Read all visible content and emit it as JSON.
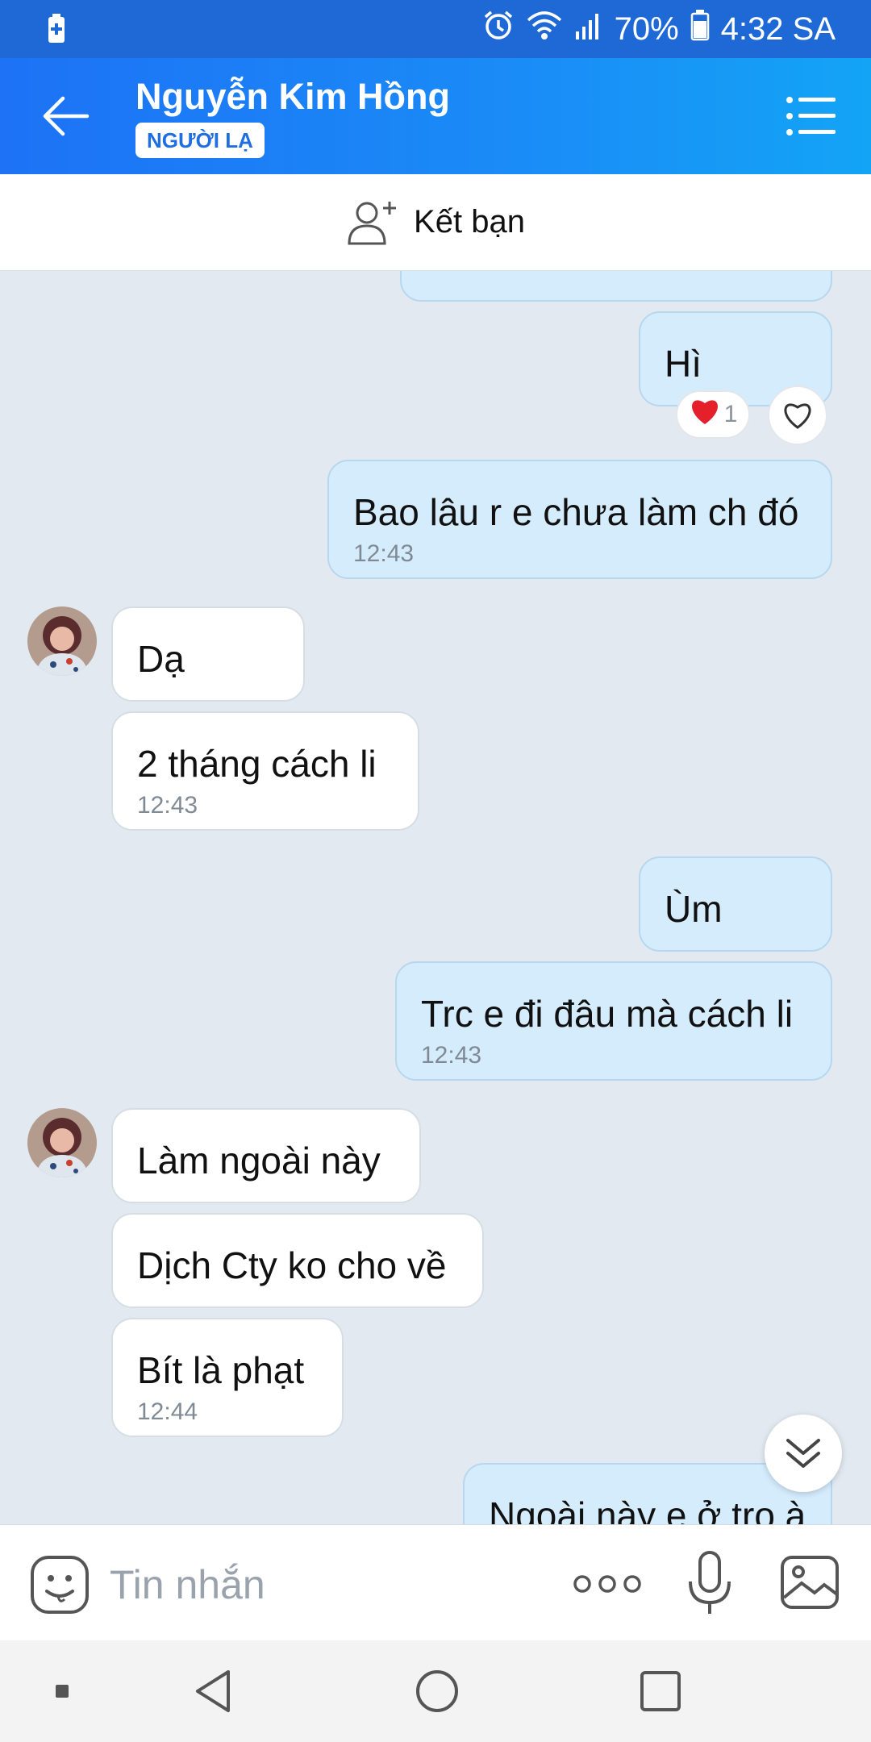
{
  "status_bar": {
    "battery_percent": "70%",
    "time": "4:32 SA",
    "icons": [
      "battery-saver-icon",
      "alarm-icon",
      "wifi-icon",
      "signal-icon",
      "battery-icon"
    ]
  },
  "header": {
    "name": "Nguyễn Kim Hồng",
    "badge": "NGƯỜI LẠ",
    "accent_color": "#1d72f5"
  },
  "friend_bar": {
    "label": "Kết bạn"
  },
  "messages": [
    {
      "id": "m0",
      "side": "sent",
      "text": "",
      "partial": true
    },
    {
      "id": "m1",
      "side": "sent",
      "text": "Hì",
      "reaction": {
        "emoji": "heart",
        "count": "1"
      }
    },
    {
      "id": "m2",
      "side": "sent",
      "text": "Bao lâu r e chưa làm ch đó",
      "time": "12:43"
    },
    {
      "id": "m3",
      "side": "received",
      "text": "Dạ"
    },
    {
      "id": "m4",
      "side": "received",
      "text": "2 tháng cách li",
      "time": "12:43"
    },
    {
      "id": "m5",
      "side": "sent",
      "text": "Ùm"
    },
    {
      "id": "m6",
      "side": "sent",
      "text": "Trc e đi đâu mà cách li",
      "time": "12:43"
    },
    {
      "id": "m7",
      "side": "received",
      "text": "Làm ngoài này"
    },
    {
      "id": "m8",
      "side": "received",
      "text": "Dịch Cty ko cho về"
    },
    {
      "id": "m9",
      "side": "received",
      "text": "Bít là phạt",
      "time": "12:44"
    },
    {
      "id": "m10",
      "side": "sent",
      "text": "Ngoài này e ở tro à",
      "partial": true
    }
  ],
  "composer": {
    "placeholder": "Tin nhắn"
  },
  "colors": {
    "sent_bubble": "#d5ecfd",
    "received_bubble": "#ffffff",
    "chat_background": "#e2e9f1",
    "status_bar": "#1f69d6"
  }
}
